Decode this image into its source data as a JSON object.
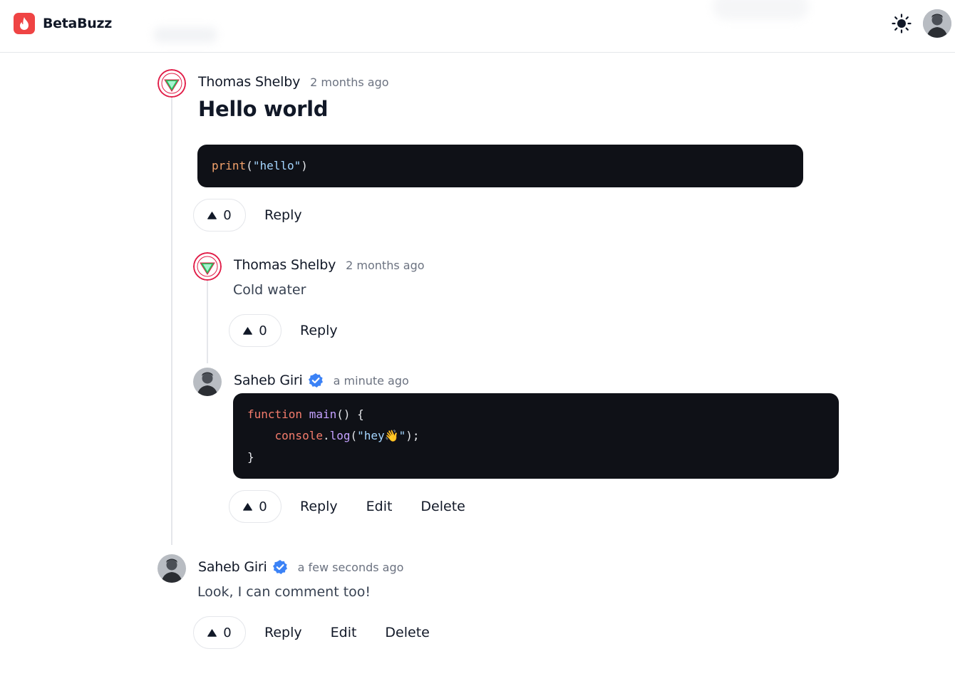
{
  "app": {
    "name": "BetaBuzz"
  },
  "comments": [
    {
      "author": "Thomas Shelby",
      "time": "2 months ago",
      "title": "Hello world",
      "code": "print(\"hello\")",
      "votes": "0",
      "actions": [
        "Reply"
      ]
    },
    {
      "author": "Thomas Shelby",
      "time": "2 months ago",
      "body": "Cold water",
      "votes": "0",
      "actions": [
        "Reply"
      ]
    },
    {
      "author": "Saheb Giri",
      "verified": true,
      "time": "a minute ago",
      "code_lines": [
        "function main() {",
        "    console.log(\"hey👋\");",
        "}"
      ],
      "votes": "0",
      "actions": [
        "Reply",
        "Edit",
        "Delete"
      ]
    },
    {
      "author": "Saheb Giri",
      "verified": true,
      "time": "a few seconds ago",
      "body": "Look, I can comment too!",
      "votes": "0",
      "actions": [
        "Reply",
        "Edit",
        "Delete"
      ]
    }
  ],
  "icons": {
    "logo": "flame-icon",
    "theme": "sun-icon",
    "vote": "triangle-up-icon",
    "verified": "verified-badge-icon"
  },
  "colors": {
    "brand": "#ef4444",
    "verified": "#3b82f6",
    "code_bg": "#0f1117"
  }
}
